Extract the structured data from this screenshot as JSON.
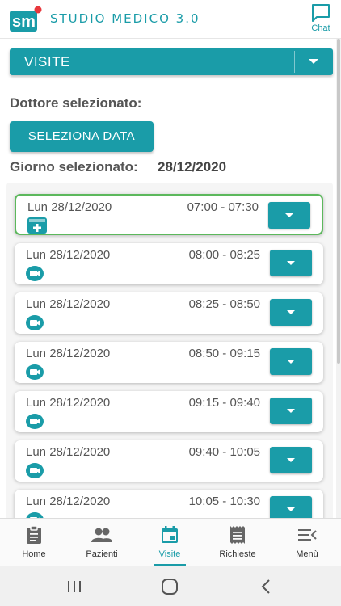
{
  "header": {
    "logo_text": "sm",
    "title": "STUDIO MEDICO 3.0",
    "chat_label": "Chat"
  },
  "visit_select": {
    "selected": "VISITE"
  },
  "doctor": {
    "label": "Dottore selezionato:"
  },
  "select_date_button": "SELEZIONA DATA",
  "selected_day": {
    "label": "Giorno selezionato:",
    "value": "28/12/2020"
  },
  "slots": [
    {
      "date": "Lun 28/12/2020",
      "time": "07:00 - 07:30",
      "icon": "calendar-plus-icon",
      "selected": true
    },
    {
      "date": "Lun 28/12/2020",
      "time": "08:00 - 08:25",
      "icon": "video-icon",
      "selected": false
    },
    {
      "date": "Lun 28/12/2020",
      "time": "08:25 - 08:50",
      "icon": "video-icon",
      "selected": false
    },
    {
      "date": "Lun 28/12/2020",
      "time": "08:50 - 09:15",
      "icon": "video-icon",
      "selected": false
    },
    {
      "date": "Lun 28/12/2020",
      "time": "09:15 - 09:40",
      "icon": "video-icon",
      "selected": false
    },
    {
      "date": "Lun 28/12/2020",
      "time": "09:40 - 10:05",
      "icon": "video-icon",
      "selected": false
    },
    {
      "date": "Lun 28/12/2020",
      "time": "10:05 - 10:30",
      "icon": "video-icon",
      "selected": false
    }
  ],
  "nav": {
    "items": [
      {
        "label": "Home",
        "icon": "clipboard-icon"
      },
      {
        "label": "Pazienti",
        "icon": "people-icon"
      },
      {
        "label": "Visite",
        "icon": "calendar-icon",
        "active": true
      },
      {
        "label": "Richieste",
        "icon": "receipt-icon"
      },
      {
        "label": "Menù",
        "icon": "menu-icon"
      }
    ]
  },
  "colors": {
    "accent": "#1a9ca8",
    "selected_border": "#5cb85c"
  }
}
